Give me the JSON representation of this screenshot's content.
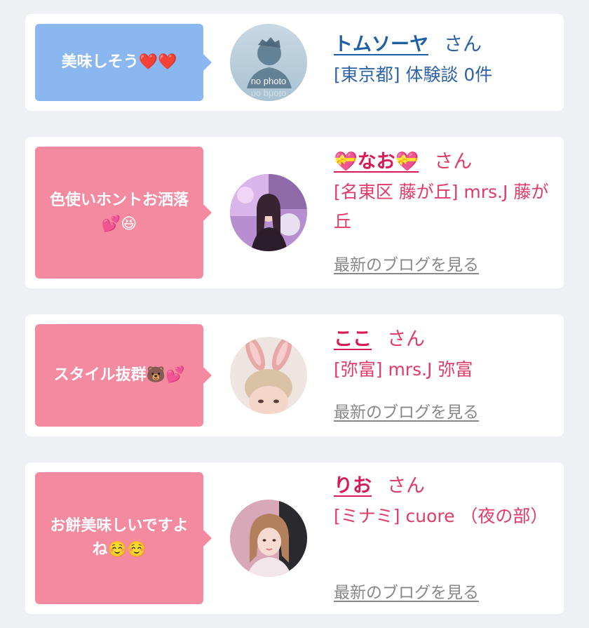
{
  "reviews": [
    {
      "comment": "美味しそう❤️❤️",
      "name": "トムソーヤ",
      "honorific": "さん",
      "meta": "[東京都] 体験談 0件",
      "avatar_caption": "no photo"
    },
    {
      "comment": "色使いホントお洒落💕😆",
      "name": "💝なお💝",
      "honorific": "さん",
      "meta": "[名東区 藤が丘] mrs.J 藤が丘",
      "blog_link": "最新のブログを見る"
    },
    {
      "comment": "スタイル抜群🐻💕",
      "name": "ここ",
      "honorific": "さん",
      "meta": "[弥富] mrs.J 弥富",
      "blog_link": "最新のブログを見る"
    },
    {
      "comment": "お餅美味しいですよね☺️☺️",
      "name": "りお",
      "honorific": "さん",
      "meta": "[ミナミ] cuore （夜の部）",
      "blog_link": "最新のブログを見る"
    }
  ],
  "colors": {
    "background": "#eef0f3",
    "bubble_blue": "#8bb7f0",
    "bubble_pink": "#f48aa0",
    "name_blue": "#1f5ea8",
    "name_pink": "#d81b55",
    "link_gray": "#888888"
  }
}
